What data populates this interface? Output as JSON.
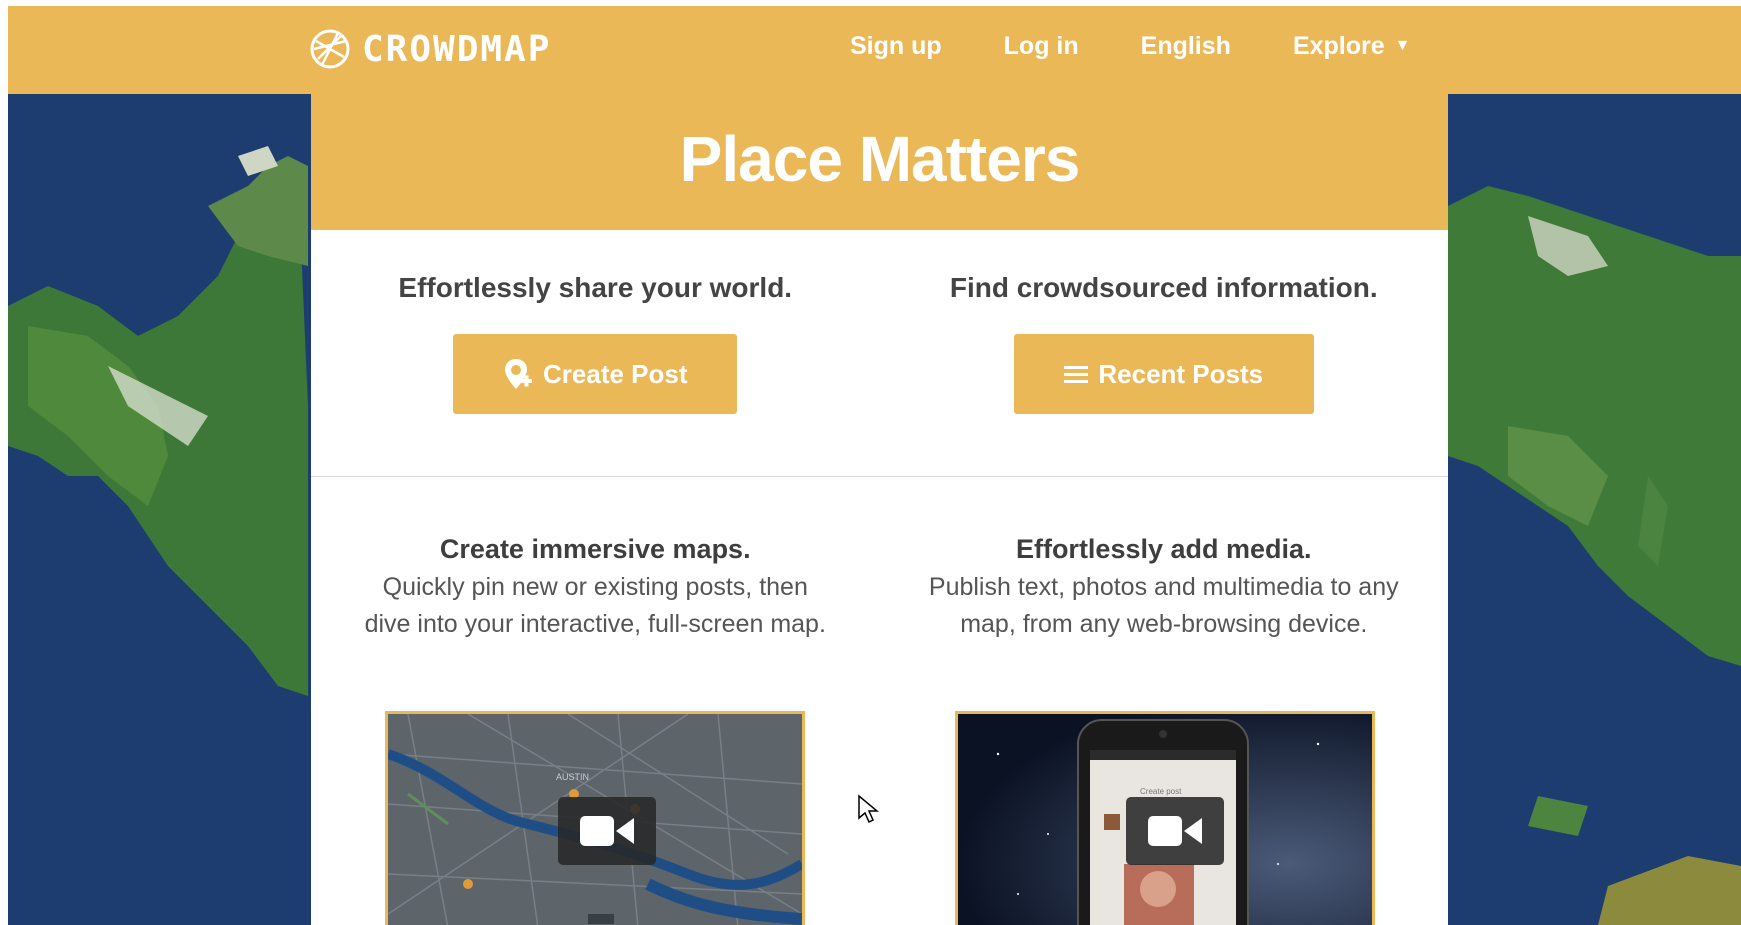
{
  "header": {
    "logo_text": "CROWDMAP",
    "nav": [
      "Sign up",
      "Log in",
      "English",
      "Explore"
    ],
    "explore_caret": "▼"
  },
  "hero": {
    "title": "Place Matters"
  },
  "actions": {
    "left": {
      "tagline": "Effortlessly share your world.",
      "button": "Create Post",
      "icon": "map-pin-plus-icon"
    },
    "right": {
      "tagline": "Find crowdsourced information.",
      "button": "Recent Posts",
      "icon": "list-icon"
    }
  },
  "features": {
    "left": {
      "title": "Create immersive maps.",
      "description": "Quickly pin new or existing posts, then dive into your interactive, full-screen map.",
      "map_label": "AUSTIN"
    },
    "right": {
      "title": "Effortlessly add media.",
      "description": "Publish text, photos and multimedia to any map, from any web-browsing device.",
      "phone_screen_title": "Create post"
    }
  },
  "colors": {
    "accent": "#ebb858",
    "ocean": "#1e3f73",
    "land": "#3f7a3a",
    "text": "#444444"
  }
}
